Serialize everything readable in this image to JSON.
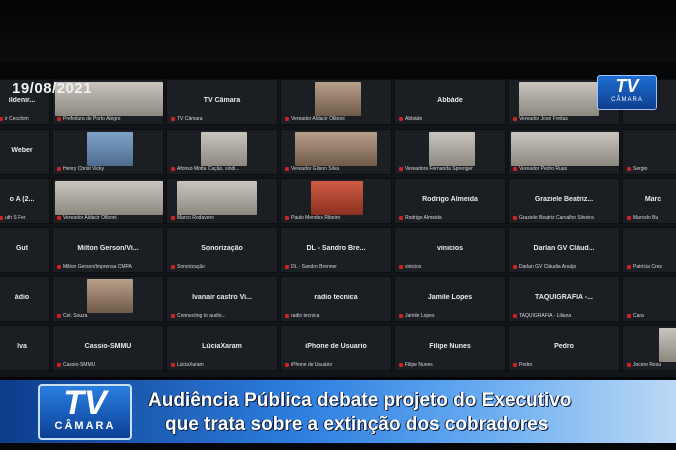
{
  "date": "19/08/2021",
  "channel_logo": {
    "tv": "TV",
    "camara": "CÂMARA"
  },
  "banner": {
    "line1": "Audiência Pública debate projeto do Executivo",
    "line2": "que trata sobre a extinção dos cobradores"
  },
  "tiles": [
    {
      "center": "ildenir...",
      "foot": "ir Cecchim"
    },
    {
      "center": "",
      "foot": "Prefeitura de Porto Alegre"
    },
    {
      "center": "TV Câmara",
      "foot": "TV Câmara"
    },
    {
      "center": "",
      "foot": "Vereador Aldacir Oliboni"
    },
    {
      "center": "Abbáde",
      "foot": "Abbáde"
    },
    {
      "center": "",
      "foot": "Vereador José Freitas"
    },
    {
      "center": "",
      "foot": ""
    },
    {
      "center": "Weber",
      "foot": ""
    },
    {
      "center": "",
      "foot": "Henry Christ Vicky"
    },
    {
      "center": "",
      "foot": "Afonso Motta Cação, sindi..."
    },
    {
      "center": "",
      "foot": "Vereador Gilson Silva"
    },
    {
      "center": "",
      "foot": "Vereadora Fernanda Sprenger"
    },
    {
      "center": "",
      "foot": "Vereador Pedro Ruas"
    },
    {
      "center": "",
      "foot": "Sergio"
    },
    {
      "center": "o A (2...",
      "foot": "uth S Fer"
    },
    {
      "center": "",
      "foot": "Vereador Aldacir Oliboni"
    },
    {
      "center": "",
      "foot": "Marco Rodavero"
    },
    {
      "center": "",
      "foot": "Paulo Mendes Ribeiro"
    },
    {
      "center": "Rodrigo Almeida",
      "foot": "Rodrigo Almeida"
    },
    {
      "center": "Graziele Beatriz...",
      "foot": "Graziele Beatriz Carvalho Silveira"
    },
    {
      "center": "Marc",
      "foot": "Marcelo Bu"
    },
    {
      "center": "Gut",
      "foot": ""
    },
    {
      "center": "Milton Gerson/Vi...",
      "foot": "Milton Gerson/Imprensa CMPA"
    },
    {
      "center": "Sonorização",
      "foot": "Sonorização"
    },
    {
      "center": "DL - Sandro Bre...",
      "foot": "DL - Sandro Brenner"
    },
    {
      "center": "vinicios",
      "foot": "vinicios"
    },
    {
      "center": "Darlan GV Cláud...",
      "foot": "Darlan GV Cláudia Araújo"
    },
    {
      "center": "",
      "foot": "Patrícia Cres"
    },
    {
      "center": "ádio",
      "foot": ""
    },
    {
      "center": "",
      "foot": "Cel. Souza"
    },
    {
      "center": "Ivanair castro Vi...",
      "foot": "Connecting to audio..."
    },
    {
      "center": "radio tecnica",
      "foot": "radio tecnica"
    },
    {
      "center": "Jamile Lopes",
      "foot": "Jamile Lopes"
    },
    {
      "center": "TAQUIGRAFIA -...",
      "foot": "TAQUIGRAFIA - Liliana"
    },
    {
      "center": "",
      "foot": "Cara"
    },
    {
      "center": "lva",
      "foot": ""
    },
    {
      "center": "Cassio-SMMU",
      "foot": "Cassio-SMMU"
    },
    {
      "center": "LúciaXaram",
      "foot": "LúciaXaram"
    },
    {
      "center": "iPhone de Usuario",
      "foot": "iPhone de Usuário"
    },
    {
      "center": "Filipe Nunes",
      "foot": "Filipe Nunes"
    },
    {
      "center": "Pedro",
      "foot": "Pedro"
    },
    {
      "center": "",
      "foot": "Jocere Resa"
    }
  ]
}
